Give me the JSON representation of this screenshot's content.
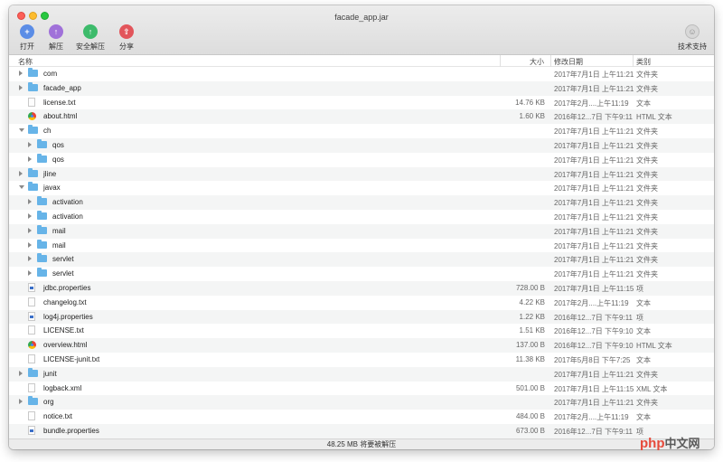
{
  "window": {
    "title": "facade_app.jar"
  },
  "toolbar": {
    "open": {
      "label": "打开",
      "icon": "open-archive-icon",
      "color": "#5b8de6"
    },
    "extract": {
      "label": "解压",
      "icon": "extract-icon",
      "color": "#a071d9"
    },
    "safe_extract": {
      "label": "安全解压",
      "icon": "safe-extract-icon",
      "color": "#3dbb6b"
    },
    "share": {
      "label": "分享",
      "icon": "share-icon",
      "color": "#e2555b"
    },
    "support": {
      "label": "技术支持",
      "icon": "support-icon"
    }
  },
  "columns": {
    "name": "名称",
    "size": "大小",
    "modified": "修改日期",
    "kind": "类别"
  },
  "files": [
    {
      "name": "com",
      "type": "folder",
      "depth": 0,
      "disclosure": "closed",
      "size": "",
      "modified": "2017年7月1日 上午11:21",
      "kind": "文件夹"
    },
    {
      "name": "facade_app",
      "type": "folder",
      "depth": 0,
      "disclosure": "closed",
      "size": "",
      "modified": "2017年7月1日 上午11:21",
      "kind": "文件夹"
    },
    {
      "name": "license.txt",
      "type": "doc",
      "depth": 0,
      "disclosure": "none",
      "size": "14.76 KB",
      "modified": "2017年2月....上午11:19",
      "kind": "文本"
    },
    {
      "name": "about.html",
      "type": "html",
      "depth": 0,
      "disclosure": "none",
      "size": "1.60 KB",
      "modified": "2016年12...7日 下午9:11",
      "kind": "HTML 文本"
    },
    {
      "name": "ch",
      "type": "folder",
      "depth": 0,
      "disclosure": "open",
      "size": "",
      "modified": "2017年7月1日 上午11:21",
      "kind": "文件夹"
    },
    {
      "name": "qos",
      "type": "folder",
      "depth": 1,
      "disclosure": "closed",
      "size": "",
      "modified": "2017年7月1日 上午11:21",
      "kind": "文件夹"
    },
    {
      "name": "qos",
      "type": "folder",
      "depth": 1,
      "disclosure": "closed",
      "size": "",
      "modified": "2017年7月1日 上午11:21",
      "kind": "文件夹"
    },
    {
      "name": "jline",
      "type": "folder",
      "depth": 0,
      "disclosure": "closed",
      "size": "",
      "modified": "2017年7月1日 上午11:21",
      "kind": "文件夹"
    },
    {
      "name": "javax",
      "type": "folder",
      "depth": 0,
      "disclosure": "open",
      "size": "",
      "modified": "2017年7月1日 上午11:21",
      "kind": "文件夹"
    },
    {
      "name": "activation",
      "type": "folder",
      "depth": 1,
      "disclosure": "closed",
      "size": "",
      "modified": "2017年7月1日 上午11:21",
      "kind": "文件夹"
    },
    {
      "name": "activation",
      "type": "folder",
      "depth": 1,
      "disclosure": "closed",
      "size": "",
      "modified": "2017年7月1日 上午11:21",
      "kind": "文件夹"
    },
    {
      "name": "mail",
      "type": "folder",
      "depth": 1,
      "disclosure": "closed",
      "size": "",
      "modified": "2017年7月1日 上午11:21",
      "kind": "文件夹"
    },
    {
      "name": "mail",
      "type": "folder",
      "depth": 1,
      "disclosure": "closed",
      "size": "",
      "modified": "2017年7月1日 上午11:21",
      "kind": "文件夹"
    },
    {
      "name": "servlet",
      "type": "folder",
      "depth": 1,
      "disclosure": "closed",
      "size": "",
      "modified": "2017年7月1日 上午11:21",
      "kind": "文件夹"
    },
    {
      "name": "servlet",
      "type": "folder",
      "depth": 1,
      "disclosure": "closed",
      "size": "",
      "modified": "2017年7月1日 上午11:21",
      "kind": "文件夹"
    },
    {
      "name": "jdbc.properties",
      "type": "props",
      "depth": 0,
      "disclosure": "none",
      "size": "728.00 B",
      "modified": "2017年7月1日 上午11:15",
      "kind": "项"
    },
    {
      "name": "changelog.txt",
      "type": "doc",
      "depth": 0,
      "disclosure": "none",
      "size": "4.22 KB",
      "modified": "2017年2月....上午11:19",
      "kind": "文本"
    },
    {
      "name": "log4j.properties",
      "type": "props",
      "depth": 0,
      "disclosure": "none",
      "size": "1.22 KB",
      "modified": "2016年12...7日 下午9:11",
      "kind": "项"
    },
    {
      "name": "LICENSE.txt",
      "type": "doc",
      "depth": 0,
      "disclosure": "none",
      "size": "1.51 KB",
      "modified": "2016年12...7日 下午9:10",
      "kind": "文本"
    },
    {
      "name": "overview.html",
      "type": "html",
      "depth": 0,
      "disclosure": "none",
      "size": "137.00 B",
      "modified": "2016年12...7日 下午9:10",
      "kind": "HTML 文本"
    },
    {
      "name": "LICENSE-junit.txt",
      "type": "doc",
      "depth": 0,
      "disclosure": "none",
      "size": "11.38 KB",
      "modified": "2017年5月8日 下午7:25",
      "kind": "文本"
    },
    {
      "name": "junit",
      "type": "folder",
      "depth": 0,
      "disclosure": "closed",
      "size": "",
      "modified": "2017年7月1日 上午11:21",
      "kind": "文件夹"
    },
    {
      "name": "logback.xml",
      "type": "doc",
      "depth": 0,
      "disclosure": "none",
      "size": "501.00 B",
      "modified": "2017年7月1日 上午11:15",
      "kind": "XML 文本"
    },
    {
      "name": "org",
      "type": "folder",
      "depth": 0,
      "disclosure": "closed",
      "size": "",
      "modified": "2017年7月1日 上午11:21",
      "kind": "文件夹"
    },
    {
      "name": "notice.txt",
      "type": "doc",
      "depth": 0,
      "disclosure": "none",
      "size": "484.00 B",
      "modified": "2017年2月....上午11:19",
      "kind": "文本"
    },
    {
      "name": "bundle.properties",
      "type": "props",
      "depth": 0,
      "disclosure": "none",
      "size": "673.00 B",
      "modified": "2016年12...7日 下午9:11",
      "kind": "项"
    }
  ],
  "status": {
    "text": "48.25 MB 将要被解压"
  },
  "watermark": {
    "php": "php",
    "cn": "中文网"
  }
}
